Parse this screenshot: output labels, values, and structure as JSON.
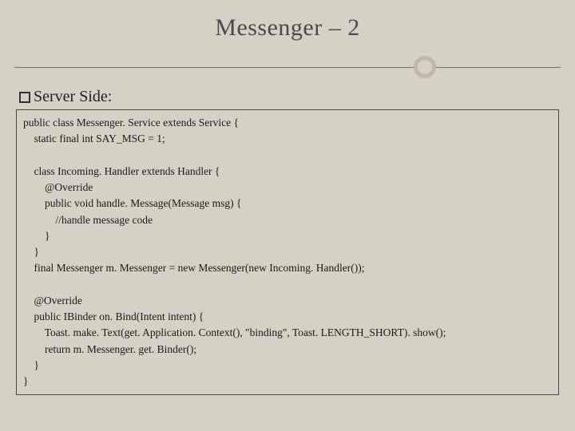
{
  "title": "Messenger – 2",
  "subheader": "Server Side:",
  "code": "public class Messenger. Service extends Service {\n    static final int SAY_MSG = 1;\n\n    class Incoming. Handler extends Handler {\n        @Override\n        public void handle. Message(Message msg) {\n            //handle message code\n        }\n    }\n    final Messenger m. Messenger = new Messenger(new Incoming. Handler());\n\n    @Override\n    public IBinder on. Bind(Intent intent) {\n        Toast. make. Text(get. Application. Context(), \"binding\", Toast. LENGTH_SHORT). show();\n        return m. Messenger. get. Binder();\n    }\n}"
}
